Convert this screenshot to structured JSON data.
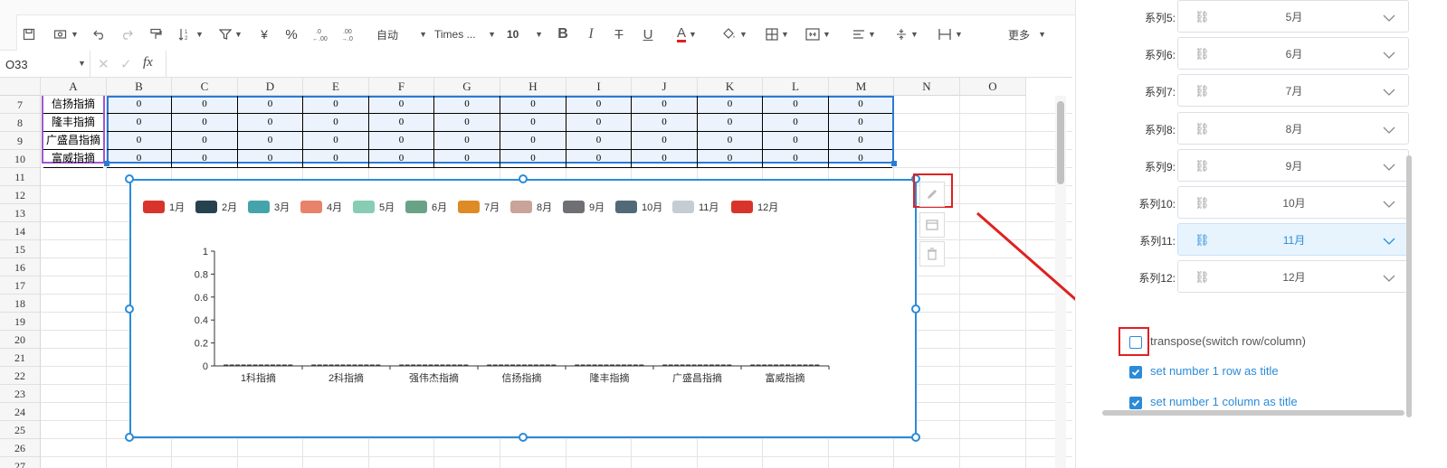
{
  "toolbar": {
    "auto_label": "自动",
    "font_name": "Times ...",
    "font_size": "10",
    "currency": "¥",
    "percent": "%",
    "dec_dec": ".0←.00",
    "more_label": "更多"
  },
  "formula_bar": {
    "cell_ref": "O33",
    "fx": "fx",
    "formula": ""
  },
  "grid": {
    "columns": [
      "A",
      "B",
      "C",
      "D",
      "E",
      "F",
      "G",
      "H",
      "I",
      "J",
      "K",
      "L",
      "M",
      "N",
      "O"
    ],
    "rows": [
      "7",
      "8",
      "9",
      "10",
      "11",
      "12",
      "13",
      "14",
      "15",
      "16",
      "17",
      "18",
      "19",
      "20",
      "21",
      "22",
      "23",
      "24",
      "25",
      "26",
      "27"
    ],
    "table_rows": [
      {
        "name": "信扬指摘",
        "values": [
          "0",
          "0",
          "0",
          "0",
          "0",
          "0",
          "0",
          "0",
          "0",
          "0",
          "0",
          "0"
        ]
      },
      {
        "name": "隆丰指摘",
        "values": [
          "0",
          "0",
          "0",
          "0",
          "0",
          "0",
          "0",
          "0",
          "0",
          "0",
          "0",
          "0"
        ]
      },
      {
        "name": "广盛昌指摘",
        "values": [
          "0",
          "0",
          "0",
          "0",
          "0",
          "0",
          "0",
          "0",
          "0",
          "0",
          "0",
          "0"
        ]
      },
      {
        "name": "富威指摘",
        "values": [
          "0",
          "0",
          "0",
          "0",
          "0",
          "0",
          "0",
          "0",
          "0",
          "0",
          "0",
          "0"
        ]
      }
    ]
  },
  "chart": {
    "legend": [
      {
        "label": "1月",
        "color": "#d9342b"
      },
      {
        "label": "2月",
        "color": "#26424f"
      },
      {
        "label": "3月",
        "color": "#45a4ab"
      },
      {
        "label": "4月",
        "color": "#e8826a"
      },
      {
        "label": "5月",
        "color": "#86cdb4"
      },
      {
        "label": "6月",
        "color": "#6aa287"
      },
      {
        "label": "7月",
        "color": "#de8b25"
      },
      {
        "label": "8月",
        "color": "#caa39a"
      },
      {
        "label": "9月",
        "color": "#6e7074"
      },
      {
        "label": "10月",
        "color": "#526a77"
      },
      {
        "label": "11月",
        "color": "#c4cdd3"
      },
      {
        "label": "12月",
        "color": "#d9342b"
      }
    ],
    "y_ticks": [
      "0",
      "0.2",
      "0.4",
      "0.6",
      "0.8",
      "1"
    ],
    "categories": [
      "1科指摘",
      "2科指摘",
      "强伟杰指摘",
      "信扬指摘",
      "隆丰指摘",
      "广盛昌指摘",
      "富威指摘"
    ]
  },
  "chart_data": {
    "type": "bar",
    "categories": [
      "1科指摘",
      "2科指摘",
      "强伟杰指摘",
      "信扬指摘",
      "隆丰指摘",
      "广盛昌指摘",
      "富威指摘"
    ],
    "series": [
      {
        "name": "1月",
        "values": [
          0,
          0,
          0,
          0,
          0,
          0,
          0
        ]
      },
      {
        "name": "2月",
        "values": [
          0,
          0,
          0,
          0,
          0,
          0,
          0
        ]
      },
      {
        "name": "3月",
        "values": [
          0,
          0,
          0,
          0,
          0,
          0,
          0
        ]
      },
      {
        "name": "4月",
        "values": [
          0,
          0,
          0,
          0,
          0,
          0,
          0
        ]
      },
      {
        "name": "5月",
        "values": [
          0,
          0,
          0,
          0,
          0,
          0,
          0
        ]
      },
      {
        "name": "6月",
        "values": [
          0,
          0,
          0,
          0,
          0,
          0,
          0
        ]
      },
      {
        "name": "7月",
        "values": [
          0,
          0,
          0,
          0,
          0,
          0,
          0
        ]
      },
      {
        "name": "8月",
        "values": [
          0,
          0,
          0,
          0,
          0,
          0,
          0
        ]
      },
      {
        "name": "9月",
        "values": [
          0,
          0,
          0,
          0,
          0,
          0,
          0
        ]
      },
      {
        "name": "10月",
        "values": [
          0,
          0,
          0,
          0,
          0,
          0,
          0
        ]
      },
      {
        "name": "11月",
        "values": [
          0,
          0,
          0,
          0,
          0,
          0,
          0
        ]
      },
      {
        "name": "12月",
        "values": [
          0,
          0,
          0,
          0,
          0,
          0,
          0
        ]
      }
    ],
    "ylim": [
      0,
      1
    ],
    "grid": false,
    "legend_position": "top-left"
  },
  "panel": {
    "series": [
      {
        "label": "系列5:",
        "value": "5月",
        "active": false
      },
      {
        "label": "系列6:",
        "value": "6月",
        "active": false
      },
      {
        "label": "系列7:",
        "value": "7月",
        "active": false
      },
      {
        "label": "系列8:",
        "value": "8月",
        "active": false
      },
      {
        "label": "系列9:",
        "value": "9月",
        "active": false
      },
      {
        "label": "系列10:",
        "value": "10月",
        "active": false
      },
      {
        "label": "系列11:",
        "value": "11月",
        "active": true
      },
      {
        "label": "系列12:",
        "value": "12月",
        "active": false
      }
    ],
    "options": [
      {
        "label": "transpose(switch row/column)",
        "checked": false
      },
      {
        "label": "set number 1 row as title",
        "checked": true
      },
      {
        "label": "set number 1 column as title",
        "checked": true
      }
    ],
    "accent_color": "#2b8bd8",
    "highlight_color": "#e02020"
  }
}
